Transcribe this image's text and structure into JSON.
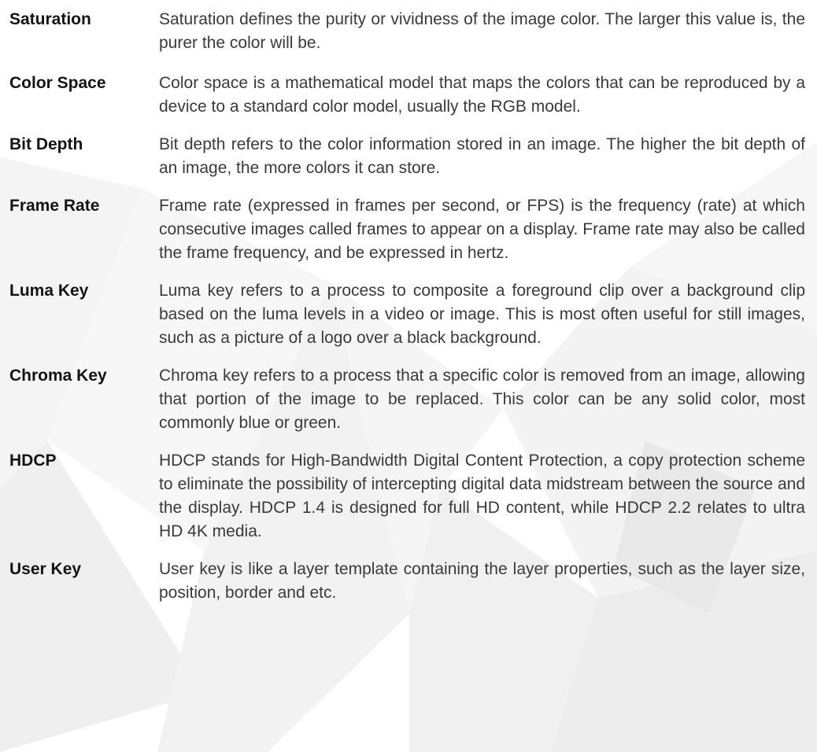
{
  "glossary": {
    "entries": [
      {
        "term": "Saturation",
        "definition": "Saturation defines the purity or vividness of the image color. The larger this value is, the purer the color will be."
      },
      {
        "term": "Color Space",
        "definition": "Color space is a mathematical model that maps the colors that can be reproduced by a device to a standard color model, usually the RGB model."
      },
      {
        "term": "Bit Depth",
        "definition": "Bit depth refers to the color information stored in an image. The higher the bit depth of an image, the more colors it can store."
      },
      {
        "term": "Frame Rate",
        "definition": "Frame rate (expressed in frames per second, or FPS) is the frequency (rate) at which consecutive images called frames to appear on a display. Frame rate may also be called the frame frequency, and be expressed in hertz."
      },
      {
        "term": "Luma Key",
        "definition": "Luma key refers to a process to composite a foreground clip over a background clip based on the luma levels in a video or image. This is most often useful for still images, such as a picture of a logo over a black background."
      },
      {
        "term": "Chroma Key",
        "definition": "Chroma key refers to a process that a specific color is removed from an image, allowing that portion of the image to be replaced. This color can be any solid color, most commonly blue or green."
      },
      {
        "term": "HDCP",
        "definition": "HDCP stands for High-Bandwidth Digital Content Protection, a copy protection scheme to eliminate the possibility of intercepting digital data midstream between the source and the display. HDCP 1.4 is designed for full HD content, while HDCP 2.2 relates to ultra HD 4K media."
      },
      {
        "term": "User Key",
        "definition": "User key is like a layer template containing the layer properties, such as the layer size, position, border and etc."
      }
    ]
  },
  "colors": {
    "term_text": "#141414",
    "definition_text": "#3a3a3a",
    "background": "#ffffff",
    "watermark_shapes": "#eeeeee"
  }
}
